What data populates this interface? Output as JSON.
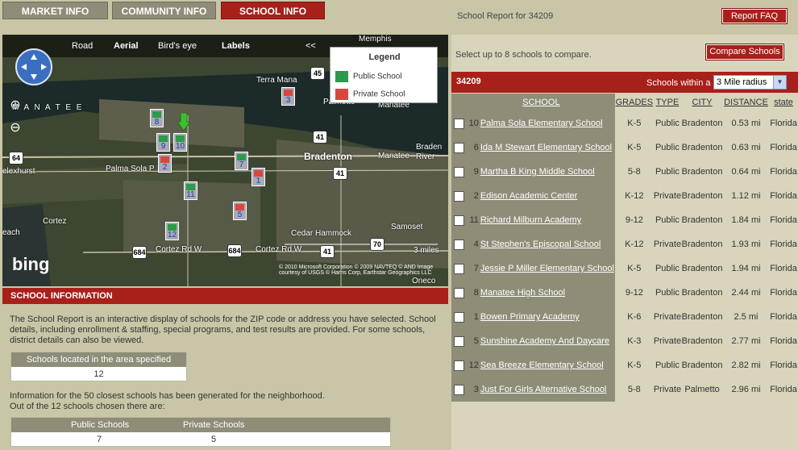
{
  "tabs": [
    {
      "label": "MARKET INFO"
    },
    {
      "label": "COMMUNITY INFO"
    },
    {
      "label": "SCHOOL INFO"
    }
  ],
  "header": {
    "report_title": "School Report for 34209",
    "faq_label": "Report FAQ"
  },
  "map": {
    "nav": {
      "road": "Road",
      "aerial": "Aerial",
      "birdseye": "Bird's eye",
      "labels": "Labels",
      "collapse": "<<"
    },
    "legend": {
      "title": "Legend",
      "public": "Public School",
      "private": "Private School"
    },
    "brand": "bing",
    "copyright": "© 2010 Microsoft Corporation  © 2009 NAVTEQ  © AND\nImage courtesy of USGS  © Harris Corp, Earthstar Geographics LLC",
    "scale_label": "3 miles",
    "labels": {
      "memphis": "Memphis",
      "terra_mana": "Terra Mana",
      "palmetto": "Palmetto",
      "manatee_map": "Manatee",
      "manatee_water": "M A N A T E E",
      "bradenton": "Bradenton",
      "braden_river": "Braden\nRiver",
      "palma_sola": "Palma Sola P",
      "exhurst": "elexhurst",
      "cortez": "Cortez",
      "cortez_rd": "Cortez Rd W",
      "cortez_rd2": "Cortez Rd W",
      "cedar_hammock": "Cedar Hammock",
      "samoset": "Samoset",
      "oneco": "Oneco",
      "each": "each"
    },
    "shields": [
      "45",
      "41",
      "64",
      "41",
      "684",
      "684",
      "41",
      "70"
    ],
    "markers": [
      "8",
      "9",
      "10",
      "2",
      "7",
      "1",
      "11",
      "5",
      "12",
      "3"
    ]
  },
  "info": {
    "header": "SCHOOL INFORMATION",
    "text": "The School Report is an interactive display of schools for the ZIP code or address you have selected. School details, including enrollment & staffing, special programs, and test results are provided. For some schools, district details can also be viewed.",
    "count_label": "Schools located in the area specified",
    "count_value": "12",
    "text2_line1": "Information for the 50 closest schools has been generated for the neighborhood.",
    "text2_line2": "Out of the 12 schools chosen there are:",
    "public_label": "Public Schools",
    "private_label": "Private Schools",
    "public_value": "7",
    "private_value": "5"
  },
  "right": {
    "select_text": "Select up to 8 schools to compare.",
    "compare_label": "Compare Schools",
    "zip": "34209",
    "within_label": "Schools within a",
    "radius_value": "3 Mile radius",
    "columns": {
      "school": "SCHOOL",
      "grades": "GRADES",
      "type": "TYPE",
      "city": "CITY",
      "distance": "DISTANCE",
      "state": "state"
    }
  },
  "schools": [
    {
      "num": "10",
      "name": "Palma Sola Elementary School",
      "grades": "K-5",
      "type": "Public",
      "city": "Bradenton",
      "distance": "0.53 mi",
      "state": "Florida"
    },
    {
      "num": "6",
      "name": "Ida M Stewart Elementary School",
      "grades": "K-5",
      "type": "Public",
      "city": "Bradenton",
      "distance": "0.63 mi",
      "state": "Florida"
    },
    {
      "num": "9",
      "name": "Martha B King Middle School",
      "grades": "5-8",
      "type": "Public",
      "city": "Bradenton",
      "distance": "0.64 mi",
      "state": "Florida"
    },
    {
      "num": "2",
      "name": "Edison Academic Center",
      "grades": "K-12",
      "type": "Private",
      "city": "Bradenton",
      "distance": "1.12 mi",
      "state": "Florida"
    },
    {
      "num": "11",
      "name": "Richard Milburn Academy",
      "grades": "9-12",
      "type": "Public",
      "city": "Bradenton",
      "distance": "1.84 mi",
      "state": "Florida"
    },
    {
      "num": "4",
      "name": "St Stephen's Episcopal School",
      "grades": "K-12",
      "type": "Private",
      "city": "Bradenton",
      "distance": "1.93 mi",
      "state": "Florida"
    },
    {
      "num": "7",
      "name": "Jessie P Miller Elementary School",
      "grades": "K-5",
      "type": "Public",
      "city": "Bradenton",
      "distance": "1.94 mi",
      "state": "Florida"
    },
    {
      "num": "8",
      "name": "Manatee High School",
      "grades": "9-12",
      "type": "Public",
      "city": "Bradenton",
      "distance": "2.44 mi",
      "state": "Florida"
    },
    {
      "num": "1",
      "name": "Bowen Primary Academy",
      "grades": "K-6",
      "type": "Private",
      "city": "Bradenton",
      "distance": "2.5 mi",
      "state": "Florida"
    },
    {
      "num": "5",
      "name": "Sunshine Academy And Daycare",
      "grades": "K-3",
      "type": "Private",
      "city": "Bradenton",
      "distance": "2.77 mi",
      "state": "Florida"
    },
    {
      "num": "12",
      "name": "Sea Breeze Elementary School",
      "grades": "K-5",
      "type": "Public",
      "city": "Bradenton",
      "distance": "2.82 mi",
      "state": "Florida"
    },
    {
      "num": "3",
      "name": "Just For Girls Alternative School",
      "grades": "5-8",
      "type": "Private",
      "city": "Palmetto",
      "distance": "2.96 mi",
      "state": "Florida"
    }
  ],
  "colors": {
    "accent": "#a8201a",
    "panel": "#c9c6a7",
    "table_header": "#8f8c78"
  }
}
